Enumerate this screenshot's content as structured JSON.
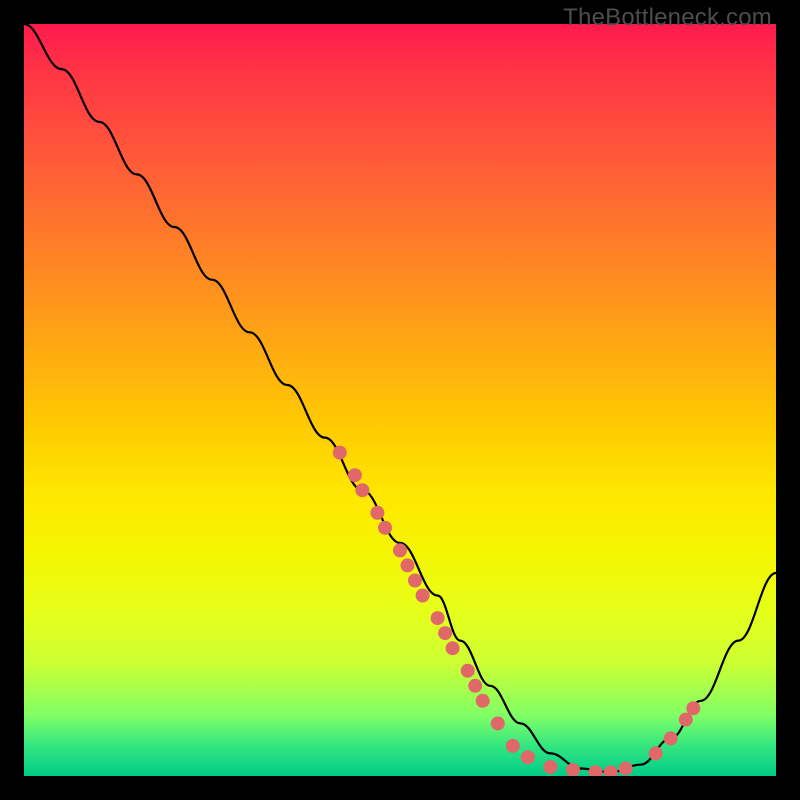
{
  "watermark": "TheBottleneck.com",
  "colors": {
    "curve_stroke": "#000000",
    "dot_fill": "#e06868",
    "background": "#000000"
  },
  "chart_data": {
    "type": "line",
    "title": "",
    "xlabel": "",
    "ylabel": "",
    "xlim": [
      0,
      100
    ],
    "ylim": [
      0,
      100
    ],
    "grid": false,
    "legend": false,
    "series": [
      {
        "name": "bottleneck-curve",
        "x": [
          0,
          5,
          10,
          15,
          20,
          25,
          30,
          35,
          40,
          45,
          50,
          55,
          58,
          62,
          66,
          70,
          74,
          78,
          82,
          86,
          90,
          95,
          100
        ],
        "y": [
          100,
          94,
          87,
          80,
          73,
          66,
          59,
          52,
          45,
          38,
          31,
          24,
          18,
          12,
          7,
          3,
          1,
          0.5,
          1.5,
          5,
          10,
          18,
          27
        ]
      }
    ],
    "dot_clusters": [
      {
        "name": "cluster-left-falling",
        "points": [
          {
            "x": 42,
            "y": 43
          },
          {
            "x": 44,
            "y": 40
          },
          {
            "x": 45,
            "y": 38
          },
          {
            "x": 47,
            "y": 35
          },
          {
            "x": 48,
            "y": 33
          },
          {
            "x": 50,
            "y": 30
          },
          {
            "x": 51,
            "y": 28
          },
          {
            "x": 52,
            "y": 26
          },
          {
            "x": 53,
            "y": 24
          },
          {
            "x": 55,
            "y": 21
          },
          {
            "x": 56,
            "y": 19
          },
          {
            "x": 57,
            "y": 17
          },
          {
            "x": 59,
            "y": 14
          },
          {
            "x": 60,
            "y": 12
          },
          {
            "x": 61,
            "y": 10
          },
          {
            "x": 63,
            "y": 7
          },
          {
            "x": 65,
            "y": 4
          },
          {
            "x": 67,
            "y": 2.5
          },
          {
            "x": 70,
            "y": 1.2
          }
        ]
      },
      {
        "name": "cluster-valley",
        "points": [
          {
            "x": 73,
            "y": 0.8
          },
          {
            "x": 76,
            "y": 0.5
          },
          {
            "x": 78,
            "y": 0.5
          },
          {
            "x": 80,
            "y": 1
          }
        ]
      },
      {
        "name": "cluster-right-rising",
        "points": [
          {
            "x": 84,
            "y": 3
          },
          {
            "x": 86,
            "y": 5
          },
          {
            "x": 88,
            "y": 7.5
          },
          {
            "x": 89,
            "y": 9
          }
        ]
      }
    ]
  }
}
